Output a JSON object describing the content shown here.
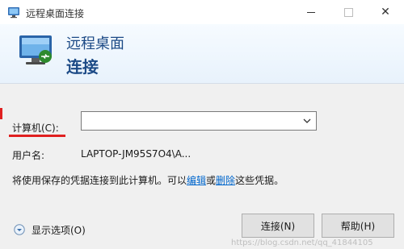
{
  "window": {
    "title": "远程桌面连接",
    "controls": {
      "minimize_icon": "minimize-icon",
      "maximize_icon": "maximize-icon",
      "close_icon": "close-icon",
      "close_glyph": "✕"
    }
  },
  "header": {
    "line1": "远程桌面",
    "line2": "连接",
    "icon": "remote-desktop-monitor-icon"
  },
  "form": {
    "computer_label": "计算机(C):",
    "computer_value": "",
    "username_label": "用户名:",
    "username_value": "LAPTOP-JM95S7O4\\A..."
  },
  "info": {
    "before": "将使用保存的凭据连接到此计算机。可以",
    "edit_link": "编辑",
    "or": "或",
    "delete_link": "删除",
    "after": "这些凭据。"
  },
  "options": {
    "label": "显示选项(O)",
    "icon": "expand-down-icon"
  },
  "buttons": {
    "connect": "连接(N)",
    "help": "帮助(H)"
  },
  "watermark": "https://blog.csdn.net/qq_41844105",
  "colors": {
    "accent_title": "#1c4a86",
    "link": "#0066cc",
    "annotation": "#e02020"
  }
}
